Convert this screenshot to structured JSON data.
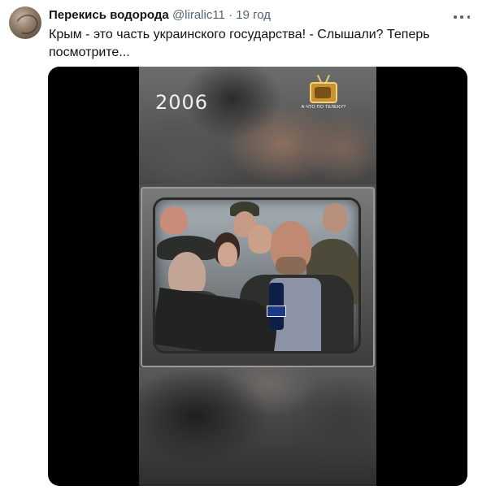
{
  "tweet": {
    "author_name": "Перекись водорода",
    "handle": "@liralic11",
    "separator": "·",
    "time": "19 год",
    "text": "Крым - это часть украинского государства! - Слышали? Теперь посмотрите..."
  },
  "media": {
    "year_overlay": "2006",
    "channel_logo_caption": "А ЧТО ПО ТЕЛЕКУ?"
  },
  "icons": {
    "more": "more-horizontal-icon",
    "avatar": "user-avatar"
  },
  "colors": {
    "text_primary": "#0f1419",
    "text_secondary": "#536471",
    "media_background": "#000000"
  }
}
